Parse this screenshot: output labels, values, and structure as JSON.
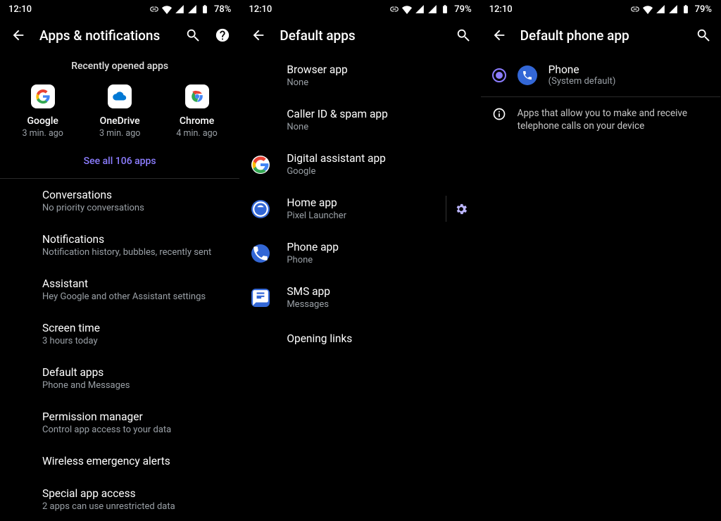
{
  "status": {
    "time": "12:10",
    "battery1": "78%",
    "battery2": "79%",
    "battery3": "79%"
  },
  "panel1": {
    "title": "Apps & notifications",
    "recent_label": "Recently opened apps",
    "recent": [
      {
        "name": "Google",
        "sub": "3 min. ago"
      },
      {
        "name": "OneDrive",
        "sub": "3 min. ago"
      },
      {
        "name": "Chrome",
        "sub": "4 min. ago"
      }
    ],
    "see_all": "See all 106 apps",
    "rows": [
      {
        "title": "Conversations",
        "sub": "No priority conversations"
      },
      {
        "title": "Notifications",
        "sub": "Notification history, bubbles, recently sent"
      },
      {
        "title": "Assistant",
        "sub": "Hey Google and other Assistant settings"
      },
      {
        "title": "Screen time",
        "sub": "3 hours today"
      },
      {
        "title": "Default apps",
        "sub": "Phone and Messages"
      },
      {
        "title": "Permission manager",
        "sub": "Control app access to your data"
      },
      {
        "title": "Wireless emergency alerts",
        "sub": ""
      },
      {
        "title": "Special app access",
        "sub": "2 apps can use unrestricted data"
      }
    ]
  },
  "panel2": {
    "title": "Default apps",
    "rows": [
      {
        "title": "Browser app",
        "sub": "None",
        "icon": "none"
      },
      {
        "title": "Caller ID & spam app",
        "sub": "None",
        "icon": "none"
      },
      {
        "title": "Digital assistant app",
        "sub": "Google",
        "icon": "google"
      },
      {
        "title": "Home app",
        "sub": "Pixel Launcher",
        "icon": "pixel",
        "gear": true
      },
      {
        "title": "Phone app",
        "sub": "Phone",
        "icon": "phone"
      },
      {
        "title": "SMS app",
        "sub": "Messages",
        "icon": "messages"
      },
      {
        "title": "Opening links",
        "sub": "",
        "icon": "none"
      }
    ]
  },
  "panel3": {
    "title": "Default phone app",
    "option": {
      "name": "Phone",
      "sub": "(System default)"
    },
    "info": "Apps that allow you to make and receive telephone calls on your device"
  }
}
